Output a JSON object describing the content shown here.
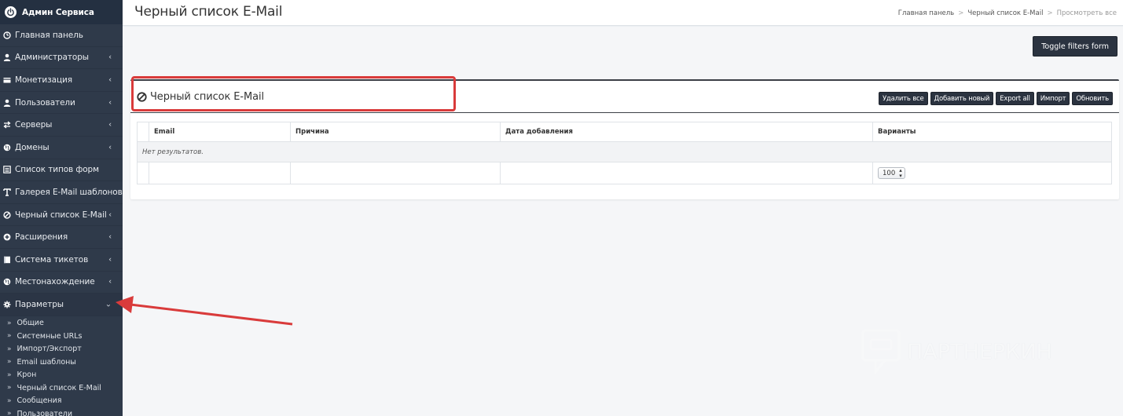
{
  "sidebar": {
    "brand": "Админ Сервиса",
    "items": [
      {
        "label": "Главная панель",
        "icon": "dashboard-icon",
        "has_arrow": false
      },
      {
        "label": "Администраторы",
        "icon": "user-icon",
        "has_arrow": true
      },
      {
        "label": "Монетизация",
        "icon": "credit-card-icon",
        "has_arrow": true
      },
      {
        "label": "Пользователи",
        "icon": "user-icon",
        "has_arrow": true
      },
      {
        "label": "Серверы",
        "icon": "exchange-icon",
        "has_arrow": true
      },
      {
        "label": "Домены",
        "icon": "globe-icon",
        "has_arrow": true
      },
      {
        "label": "Список типов форм",
        "icon": "list-icon",
        "has_arrow": false
      },
      {
        "label": "Галерея E-Mail шаблонов",
        "icon": "text-icon",
        "has_arrow": false
      },
      {
        "label": "Черный список E-Mail",
        "icon": "ban-icon",
        "has_arrow": true
      },
      {
        "label": "Расширения",
        "icon": "plus-circle-icon",
        "has_arrow": true
      },
      {
        "label": "Система тикетов",
        "icon": "ticket-icon",
        "has_arrow": true
      },
      {
        "label": "Местонахождение",
        "icon": "globe-icon",
        "has_arrow": true
      },
      {
        "label": "Параметры",
        "icon": "gear-icon",
        "has_arrow": true
      }
    ],
    "params_submenu": [
      "Общие",
      "Системные URLs",
      "Импорт/Экспорт",
      "Email шаблоны",
      "Крон",
      "Черный список E-Mail",
      "Сообщения",
      "Пользователи"
    ],
    "arrow_closed": "‹",
    "arrow_open": "⌄",
    "sub_bullet": "»"
  },
  "header": {
    "title": "Черный список E-Mail",
    "breadcrumb": [
      "Главная панель",
      "Черный список E-Mail",
      "Просмотреть все"
    ],
    "breadcrumb_sep": ">"
  },
  "toolbar": {
    "toggle_filters": "Toggle filters form"
  },
  "panel": {
    "title": "Черный список E-Mail",
    "actions": {
      "delete_all": "Удалить все",
      "add_new": "Добавить новый",
      "export_all": "Export all",
      "import": "Импорт",
      "refresh": "Обновить"
    }
  },
  "table": {
    "columns": [
      "Email",
      "Причина",
      "Дата добавления",
      "Варианты"
    ],
    "empty_text": "Нет результатов.",
    "per_page": "100"
  },
  "watermark": {
    "text": "ПАРТНЕРКИН"
  },
  "colors": {
    "sidebar_bg": "#2f3a4a",
    "button_bg": "#2b3340",
    "annotation_red": "#d93b3b"
  }
}
